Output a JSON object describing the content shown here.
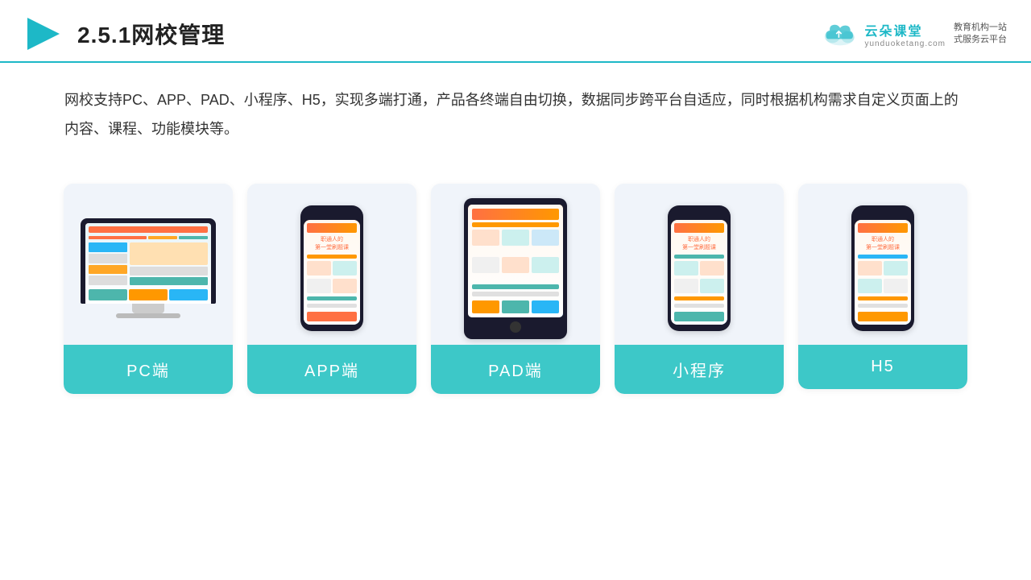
{
  "header": {
    "title": "2.5.1网校管理",
    "brand_name": "云朵课堂",
    "brand_url": "yunduoketang.com",
    "brand_slogan": "教育机构一站\n式服务云平台"
  },
  "description": {
    "text": "网校支持PC、APP、PAD、小程序、H5，实现多端打通，产品各终端自由切换，数据同步跨平台自适应，同时根据机构需求自定义页面上的内容、课程、功能模块等。"
  },
  "cards": [
    {
      "id": "pc",
      "label": "PC端"
    },
    {
      "id": "app",
      "label": "APP端"
    },
    {
      "id": "pad",
      "label": "PAD端"
    },
    {
      "id": "miniprogram",
      "label": "小程序"
    },
    {
      "id": "h5",
      "label": "H5"
    }
  ]
}
